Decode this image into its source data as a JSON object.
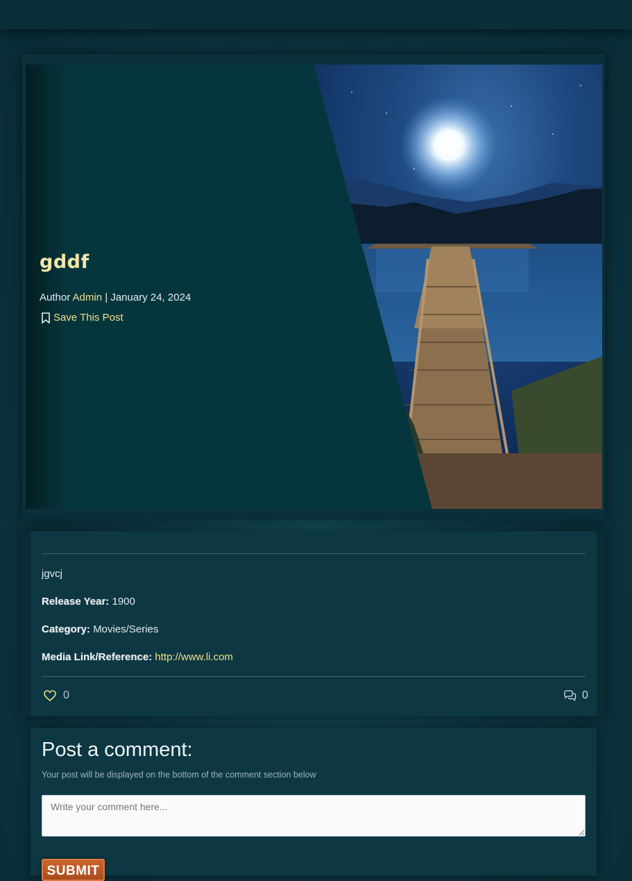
{
  "post": {
    "title": "gddf",
    "author_prefix": "Author",
    "author_name": "Admin",
    "separator": "|",
    "date": "January 24, 2024",
    "save_label": "Save This Post",
    "description": "jgvcj",
    "release_year_label": "Release Year:",
    "release_year": "1900",
    "category_label": "Category:",
    "category": "Movies/Series",
    "media_link_label": "Media Link/Reference:",
    "media_link": "http://www.li.com",
    "likes": "0",
    "comments": "0"
  },
  "comment_form": {
    "title": "Post a comment:",
    "subtitle": "Your post will be displayed on the bottom of the comment section below",
    "placeholder": "Write your comment here...",
    "submit_label": "SUBMIT"
  },
  "colors": {
    "accent_link": "#f0e08a",
    "title": "#f4e6a8",
    "background": "#0d3440",
    "submit": "#c9642e"
  }
}
